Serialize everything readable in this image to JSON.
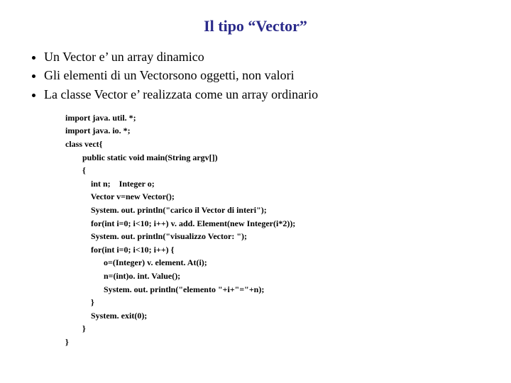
{
  "title": "Il tipo “Vector”",
  "bullets": [
    "Un Vector e’ un array dinamico",
    "Gli elementi di un Vectorsono oggetti, non valori",
    "La classe Vector e’ realizzata come un array ordinario"
  ],
  "code_lines": [
    "import java. util. *;",
    "import java. io. *;",
    "class vect{",
    "        public static void main(String argv[])",
    "        {",
    "            int n;    Integer o;",
    "            Vector v=new Vector();",
    "            System. out. println(\"carico il Vector di interi\");",
    "            for(int i=0; i<10; i++) v. add. Element(new Integer(i*2));",
    "            System. out. println(\"visualizzo Vector: \");",
    "            for(int i=0; i<10; i++) {",
    "                  o=(Integer) v. element. At(i);",
    "                  n=(int)o. int. Value();",
    "                  System. out. println(\"elemento \"+i+\"=\"+n);",
    "            }",
    "            System. exit(0);",
    "        }",
    "}"
  ]
}
